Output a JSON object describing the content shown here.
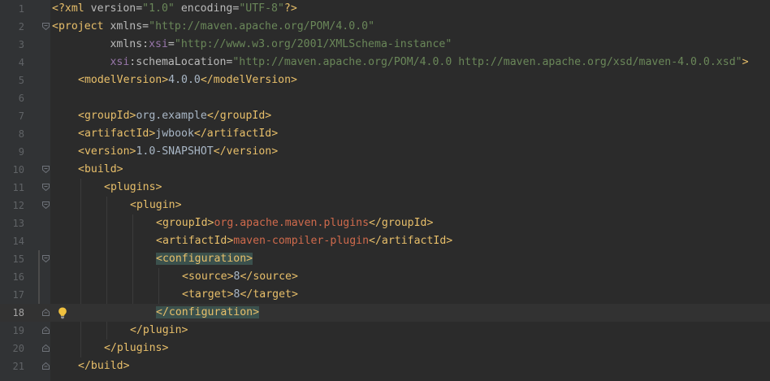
{
  "editor": {
    "file_language": "xml",
    "current_line": 18,
    "lines": [
      {
        "n": "1",
        "indent": 0,
        "fold": "none",
        "tokens": [
          {
            "t": "<?xml ",
            "c": "t-pi"
          },
          {
            "t": "version",
            "c": "t-attr"
          },
          {
            "t": "=",
            "c": "t-attr"
          },
          {
            "t": "\"1.0\"",
            "c": "t-val"
          },
          {
            "t": " ",
            "c": "t-text"
          },
          {
            "t": "encoding",
            "c": "t-attr"
          },
          {
            "t": "=",
            "c": "t-attr"
          },
          {
            "t": "\"UTF-8\"",
            "c": "t-val"
          },
          {
            "t": "?>",
            "c": "t-pi"
          }
        ]
      },
      {
        "n": "2",
        "indent": 0,
        "fold": "open",
        "tokens": [
          {
            "t": "<project ",
            "c": "t-tag"
          },
          {
            "t": "xmlns",
            "c": "t-attr"
          },
          {
            "t": "=",
            "c": "t-attr"
          },
          {
            "t": "\"http://maven.apache.org/POM/4.0.0\"",
            "c": "t-val"
          }
        ]
      },
      {
        "n": "3",
        "indent": 0,
        "fold": "none",
        "tokens": [
          {
            "t": "         xmlns:",
            "c": "t-attr"
          },
          {
            "t": "xsi",
            "c": "t-ns"
          },
          {
            "t": "=",
            "c": "t-attr"
          },
          {
            "t": "\"http://www.w3.org/2001/XMLSchema-instance\"",
            "c": "t-val"
          }
        ]
      },
      {
        "n": "4",
        "indent": 0,
        "fold": "none",
        "tokens": [
          {
            "t": "         ",
            "c": "t-text"
          },
          {
            "t": "xsi",
            "c": "t-ns"
          },
          {
            "t": ":schemaLocation",
            "c": "t-attr"
          },
          {
            "t": "=",
            "c": "t-attr"
          },
          {
            "t": "\"http://maven.apache.org/POM/4.0.0 http://maven.apache.org/xsd/maven-4.0.0.xsd\"",
            "c": "t-val"
          },
          {
            "t": ">",
            "c": "t-tag"
          }
        ]
      },
      {
        "n": "5",
        "indent": 4,
        "fold": "none",
        "tokens": [
          {
            "t": "<modelVersion>",
            "c": "t-tag"
          },
          {
            "t": "4.0.0",
            "c": "t-text"
          },
          {
            "t": "</modelVersion>",
            "c": "t-tag"
          }
        ]
      },
      {
        "n": "6",
        "indent": 0,
        "fold": "none",
        "tokens": []
      },
      {
        "n": "7",
        "indent": 4,
        "fold": "none",
        "tokens": [
          {
            "t": "<groupId>",
            "c": "t-tag"
          },
          {
            "t": "org.example",
            "c": "t-text"
          },
          {
            "t": "</groupId>",
            "c": "t-tag"
          }
        ]
      },
      {
        "n": "8",
        "indent": 4,
        "fold": "none",
        "tokens": [
          {
            "t": "<artifactId>",
            "c": "t-tag"
          },
          {
            "t": "jwbook",
            "c": "t-text"
          },
          {
            "t": "</artifactId>",
            "c": "t-tag"
          }
        ]
      },
      {
        "n": "9",
        "indent": 4,
        "fold": "none",
        "tokens": [
          {
            "t": "<version>",
            "c": "t-tag"
          },
          {
            "t": "1.0-SNAPSHOT",
            "c": "t-text"
          },
          {
            "t": "</version>",
            "c": "t-tag"
          }
        ]
      },
      {
        "n": "10",
        "indent": 4,
        "fold": "open",
        "tokens": [
          {
            "t": "<build>",
            "c": "t-tag"
          }
        ]
      },
      {
        "n": "11",
        "indent": 8,
        "fold": "open",
        "tokens": [
          {
            "t": "<plugins>",
            "c": "t-tag"
          }
        ]
      },
      {
        "n": "12",
        "indent": 12,
        "fold": "open",
        "tokens": [
          {
            "t": "<plugin>",
            "c": "t-tag"
          }
        ]
      },
      {
        "n": "13",
        "indent": 16,
        "fold": "none",
        "tokens": [
          {
            "t": "<groupId>",
            "c": "t-tag"
          },
          {
            "t": "org.apache.maven.plugins",
            "c": "t-inj"
          },
          {
            "t": "</groupId>",
            "c": "t-tag"
          }
        ]
      },
      {
        "n": "14",
        "indent": 16,
        "fold": "none",
        "tokens": [
          {
            "t": "<artifactId>",
            "c": "t-tag"
          },
          {
            "t": "maven-compiler-plugin",
            "c": "t-inj"
          },
          {
            "t": "</artifactId>",
            "c": "t-tag"
          }
        ]
      },
      {
        "n": "15",
        "indent": 16,
        "fold": "open",
        "tokens": [
          {
            "t": "<configuration>",
            "c": "t-tag hl-tag"
          }
        ]
      },
      {
        "n": "16",
        "indent": 20,
        "fold": "none",
        "tokens": [
          {
            "t": "<source>",
            "c": "t-tag"
          },
          {
            "t": "8",
            "c": "t-text"
          },
          {
            "t": "</source>",
            "c": "t-tag"
          }
        ]
      },
      {
        "n": "17",
        "indent": 20,
        "fold": "none",
        "tokens": [
          {
            "t": "<target>",
            "c": "t-tag"
          },
          {
            "t": "8",
            "c": "t-text"
          },
          {
            "t": "</target>",
            "c": "t-tag"
          }
        ]
      },
      {
        "n": "18",
        "indent": 16,
        "fold": "close",
        "tokens": [
          {
            "t": "</configuration>",
            "c": "t-tag hl-tag"
          }
        ]
      },
      {
        "n": "19",
        "indent": 12,
        "fold": "close",
        "tokens": [
          {
            "t": "</plugin>",
            "c": "t-tag"
          }
        ]
      },
      {
        "n": "20",
        "indent": 8,
        "fold": "close",
        "tokens": [
          {
            "t": "</plugins>",
            "c": "t-tag"
          }
        ]
      },
      {
        "n": "21",
        "indent": 4,
        "fold": "close",
        "tokens": [
          {
            "t": "</build>",
            "c": "t-tag"
          }
        ]
      }
    ]
  },
  "icons": {
    "fold_open": "fold-collapse-icon",
    "fold_close": "fold-end-icon",
    "intention": "lightbulb-icon"
  },
  "colors": {
    "background": "#2b2b2b",
    "gutter": "#313335",
    "tag": "#e8bf6a",
    "attribute": "#bababa",
    "namespace": "#9876aa",
    "string": "#6a8759",
    "text": "#a9b7c6",
    "injected_value": "#cf6a4c",
    "tag_match_highlight": "#3b514d"
  }
}
